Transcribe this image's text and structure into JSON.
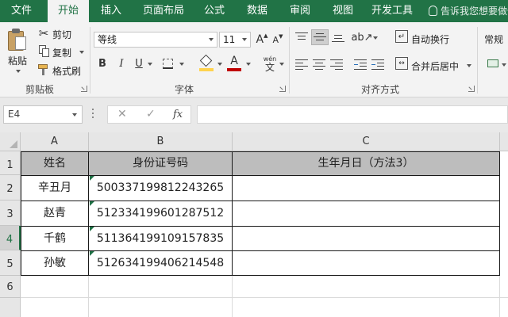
{
  "tabs": [
    {
      "label": "文件",
      "active": false
    },
    {
      "label": "开始",
      "active": true
    },
    {
      "label": "插入",
      "active": false
    },
    {
      "label": "页面布局",
      "active": false
    },
    {
      "label": "公式",
      "active": false
    },
    {
      "label": "数据",
      "active": false
    },
    {
      "label": "审阅",
      "active": false
    },
    {
      "label": "视图",
      "active": false
    },
    {
      "label": "开发工具",
      "active": false
    }
  ],
  "tell_me": "告诉我您想要做什么",
  "ribbon": {
    "clipboard": {
      "paste": "粘贴",
      "cut": "剪切",
      "copy": "复制",
      "format_painter": "格式刷",
      "group_label": "剪贴板"
    },
    "font": {
      "font_name": "等线",
      "font_size": "11",
      "bold": "B",
      "italic": "I",
      "underline": "U",
      "grow": "A",
      "shrink": "A",
      "font_color_letter": "A",
      "wen": "wén",
      "wen_char": "文",
      "fill_color": "#ffd34d",
      "font_color": "#c00000",
      "group_label": "字体"
    },
    "alignment": {
      "wrap_text": "自动换行",
      "merge_center": "合并后居中",
      "group_label": "对齐方式"
    },
    "number": {
      "format": "常规"
    }
  },
  "formula_bar": {
    "name_box": "E4",
    "cancel": "✕",
    "enter": "✓",
    "fx": "fx",
    "formula": ""
  },
  "sheet": {
    "columns": [
      "A",
      "B",
      "C"
    ],
    "rows": [
      "1",
      "2",
      "3",
      "4",
      "5",
      "6"
    ],
    "selected_row": "4",
    "header": {
      "a": "姓名",
      "b": "身份证号码",
      "c": "生年月日（方法3）"
    },
    "records": [
      {
        "name": "辛丑月",
        "id": "500337199812243265",
        "birth": ""
      },
      {
        "name": "赵青",
        "id": "512334199601287512",
        "birth": ""
      },
      {
        "name": "千鹤",
        "id": "511364199109157835",
        "birth": ""
      },
      {
        "name": "孙敏",
        "id": "512634199406214548",
        "birth": ""
      }
    ],
    "header_fill": "#bdbdbd",
    "accent": "#217346"
  }
}
